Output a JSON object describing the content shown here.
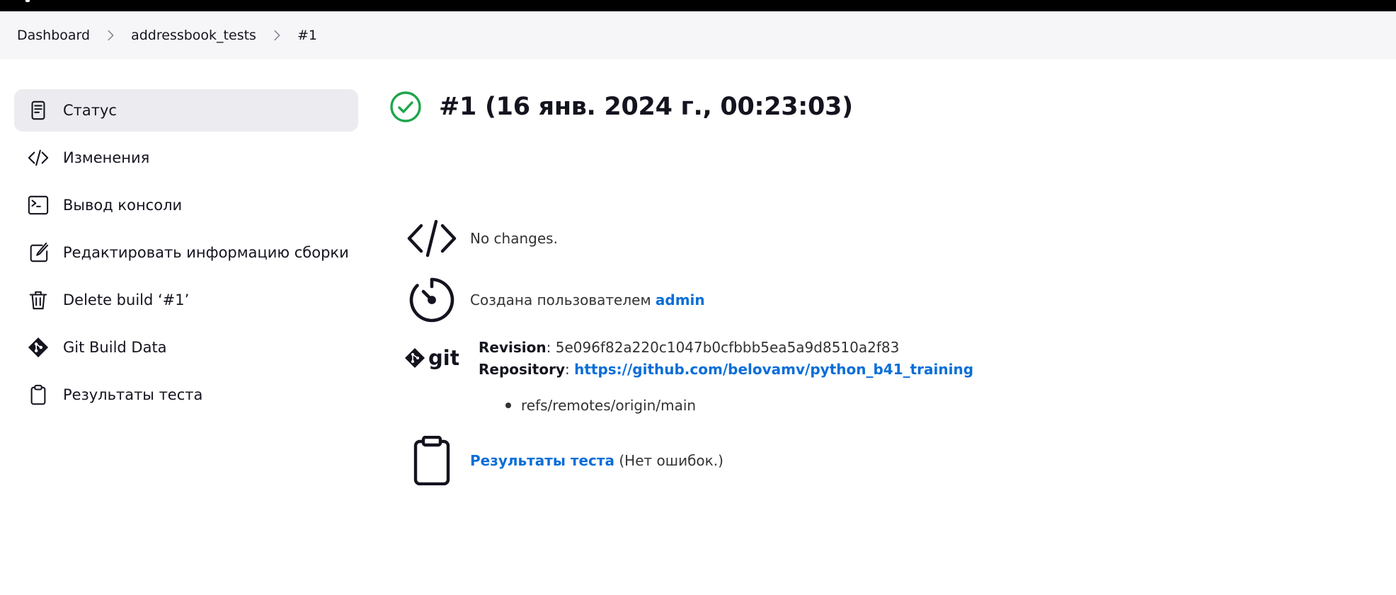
{
  "breadcrumbs": [
    {
      "label": "Dashboard"
    },
    {
      "label": "addressbook_tests"
    },
    {
      "label": "#1"
    }
  ],
  "sidebar": {
    "items": [
      {
        "label": "Статус",
        "icon": "document-icon",
        "active": true
      },
      {
        "label": "Изменения",
        "icon": "code-icon"
      },
      {
        "label": "Вывод консоли",
        "icon": "terminal-icon"
      },
      {
        "label": "Редактировать информацию сборки",
        "icon": "edit-icon"
      },
      {
        "label": "Delete build ‘#1’",
        "icon": "trash-icon"
      },
      {
        "label": "Git Build Data",
        "icon": "git-icon"
      },
      {
        "label": "Результаты теста",
        "icon": "clipboard-icon"
      }
    ]
  },
  "build": {
    "title": "#1 (16 янв. 2024 г., 00:23:03)",
    "status_icon": "success-check-icon",
    "status_color": "#1ea64b",
    "changes_text": "No changes.",
    "started_by_prefix": "Создана пользователем",
    "started_by_user": "admin",
    "revision_label": "Revision",
    "revision_value": "5e096f82a220c1047b0cfbbb5ea5a9d8510a2f83",
    "repository_label": "Repository",
    "repository_url": "https://github.com/belovamv/python_b41_training",
    "branch": "refs/remotes/origin/main",
    "test_results_link": "Результаты теста",
    "test_results_suffix": "(Нет ошибок.)"
  },
  "colors": {
    "link": "#0a6ed8",
    "breadcrumb_bg": "#f6f6f8",
    "active_item_bg": "#ececf0"
  }
}
